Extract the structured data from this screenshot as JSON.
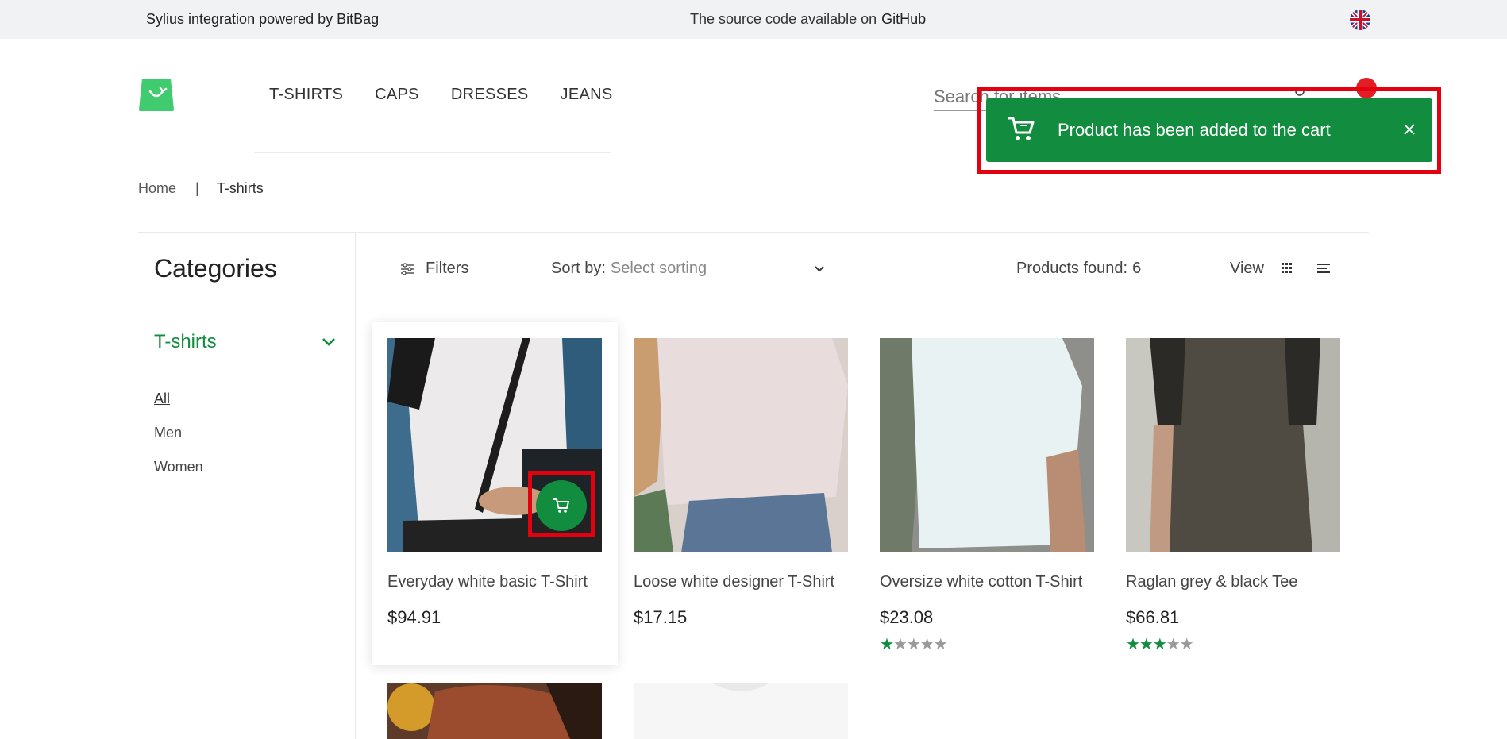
{
  "topbar": {
    "left_link": "Sylius integration powered by BitBag",
    "source_text": "The source code available on",
    "source_link": "GitHub",
    "language_icon": "uk-flag-icon"
  },
  "nav": {
    "items": [
      "T-SHIRTS",
      "CAPS",
      "DRESSES",
      "JEANS"
    ]
  },
  "search": {
    "placeholder": "Search for items"
  },
  "breadcrumb": {
    "home": "Home",
    "separator": "|",
    "current": "T-shirts"
  },
  "sidebar": {
    "title": "Categories",
    "current": "T-shirts",
    "links": [
      "All",
      "Men",
      "Women"
    ]
  },
  "toolbar": {
    "filters": "Filters",
    "sort_label": "Sort by:",
    "sort_value": "Select sorting",
    "found_label": "Products found:",
    "found_count": "6",
    "view_label": "View"
  },
  "products": [
    {
      "name": "Everyday white basic T-Shirt",
      "price": "$94.91",
      "rating": 0
    },
    {
      "name": "Loose white designer T-Shirt",
      "price": "$17.15",
      "rating": 0
    },
    {
      "name": "Oversize white cotton T-Shirt",
      "price": "$23.08",
      "rating": 1
    },
    {
      "name": "Raglan grey & black Tee",
      "price": "$66.81",
      "rating": 3
    }
  ],
  "toast": {
    "message": "Product has been added to the cart"
  },
  "colors": {
    "brand_green": "#128c3e",
    "highlight_red": "#e3000f",
    "badge_red": "#e21d24"
  }
}
